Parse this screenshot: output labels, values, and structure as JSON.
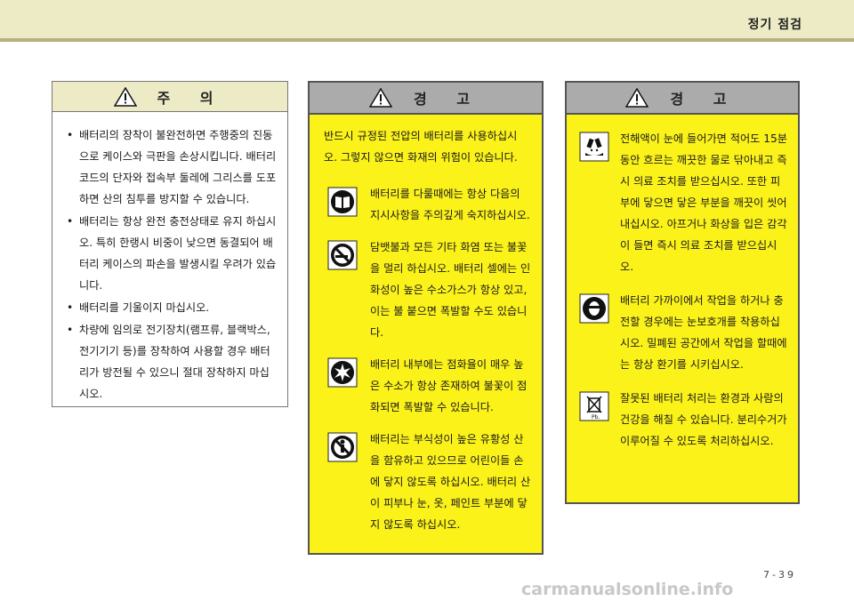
{
  "header": {
    "title": "정기 점검"
  },
  "caution": {
    "title": "주 의",
    "items": [
      "배터리의 장착이 불완전하면 주행중의 진동으로 케이스와 극판을 손상시킵니다. 배터리 코드의 단자와 접속부 둘레에 그리스를 도포하면 산의 침투를 방지할 수 있습니다.",
      "배터리는 항상 완전 충전상태로 유지 하십시오. 특히 한랭시 비중이 낮으면 동결되어 배터리 케이스의 파손을 발생시킬 우려가 있습니다.",
      "배터리를 기울이지 마십시오.",
      "차량에 임의로 전기장치(램프류, 블랙박스, 전기기기 등)를 장착하여 사용할 경우 배터리가 방전될 수 있으니 절대 장착하지 마십시오."
    ]
  },
  "warning1": {
    "title": "경 고",
    "intro": "반드시 규정된 전압의 배터리를 사용하십시오. 그렇지 않으면 화재의 위험이 있습니다.",
    "items": [
      {
        "icon": "manual-icon",
        "text": "배터리를 다룰때에는 항상 다음의 지시사항을 주의깊게 숙지하십시오."
      },
      {
        "icon": "no-smoking-icon",
        "text": "담뱃불과 모든 기타 화염 또는 불꽃을 멀리 하십시오. 배터리 셀에는 인화성이 높은 수소가스가 항상 있고, 이는 불 붙으면 폭발할 수도 있습니다."
      },
      {
        "icon": "explosion-icon",
        "text": "배터리 내부에는 점화율이 매우 높은 수소가 항상 존재하여 불꽃이 점화되면 폭발할 수 있습니다."
      },
      {
        "icon": "keep-away-children-icon",
        "text": "배터리는 부식성이 높은 유황성 산을 함유하고 있으므로 어린이들 손에 닿지 않도록 하십시오. 배터리 산이 피부나 눈, 옷, 페인트 부분에 닿지 않도록 하십시오."
      }
    ]
  },
  "warning2": {
    "title": "경 고",
    "items": [
      {
        "icon": "acid-hazard-icon",
        "text": "전해액이 눈에 들어가면 적어도 15분 동안 흐르는 깨끗한 물로 닦아내고 즉시 의료 조치를 받으십시오. 또한 피부에 닿으면 닿은 부분을 깨끗이 씻어 내십시오. 아프거나 화상을 입은 감각이 들면 즉시 의료 조치를 받으십시오."
      },
      {
        "icon": "eye-protection-icon",
        "text": "배터리 가까이에서 작업을 하거나 충전할 경우에는 눈보호개를 착용하십시오. 밀폐된 공간에서 작업을 할때에는 항상 환기를 시키십시오."
      },
      {
        "icon": "recycle-bin-icon",
        "text": "잘못된 배터리 처리는 환경과 사람의 건강을 해칠 수 있습니다. 분리수거가 이루어질 수 있도록 처리하십시오.",
        "icon_label": "Pb."
      }
    ]
  },
  "footer": {
    "page": "7-39",
    "watermark": "carmanualsonline.info"
  },
  "colors": {
    "warning_bg": "#fbf21a",
    "header_bar": "#ecebc6"
  }
}
